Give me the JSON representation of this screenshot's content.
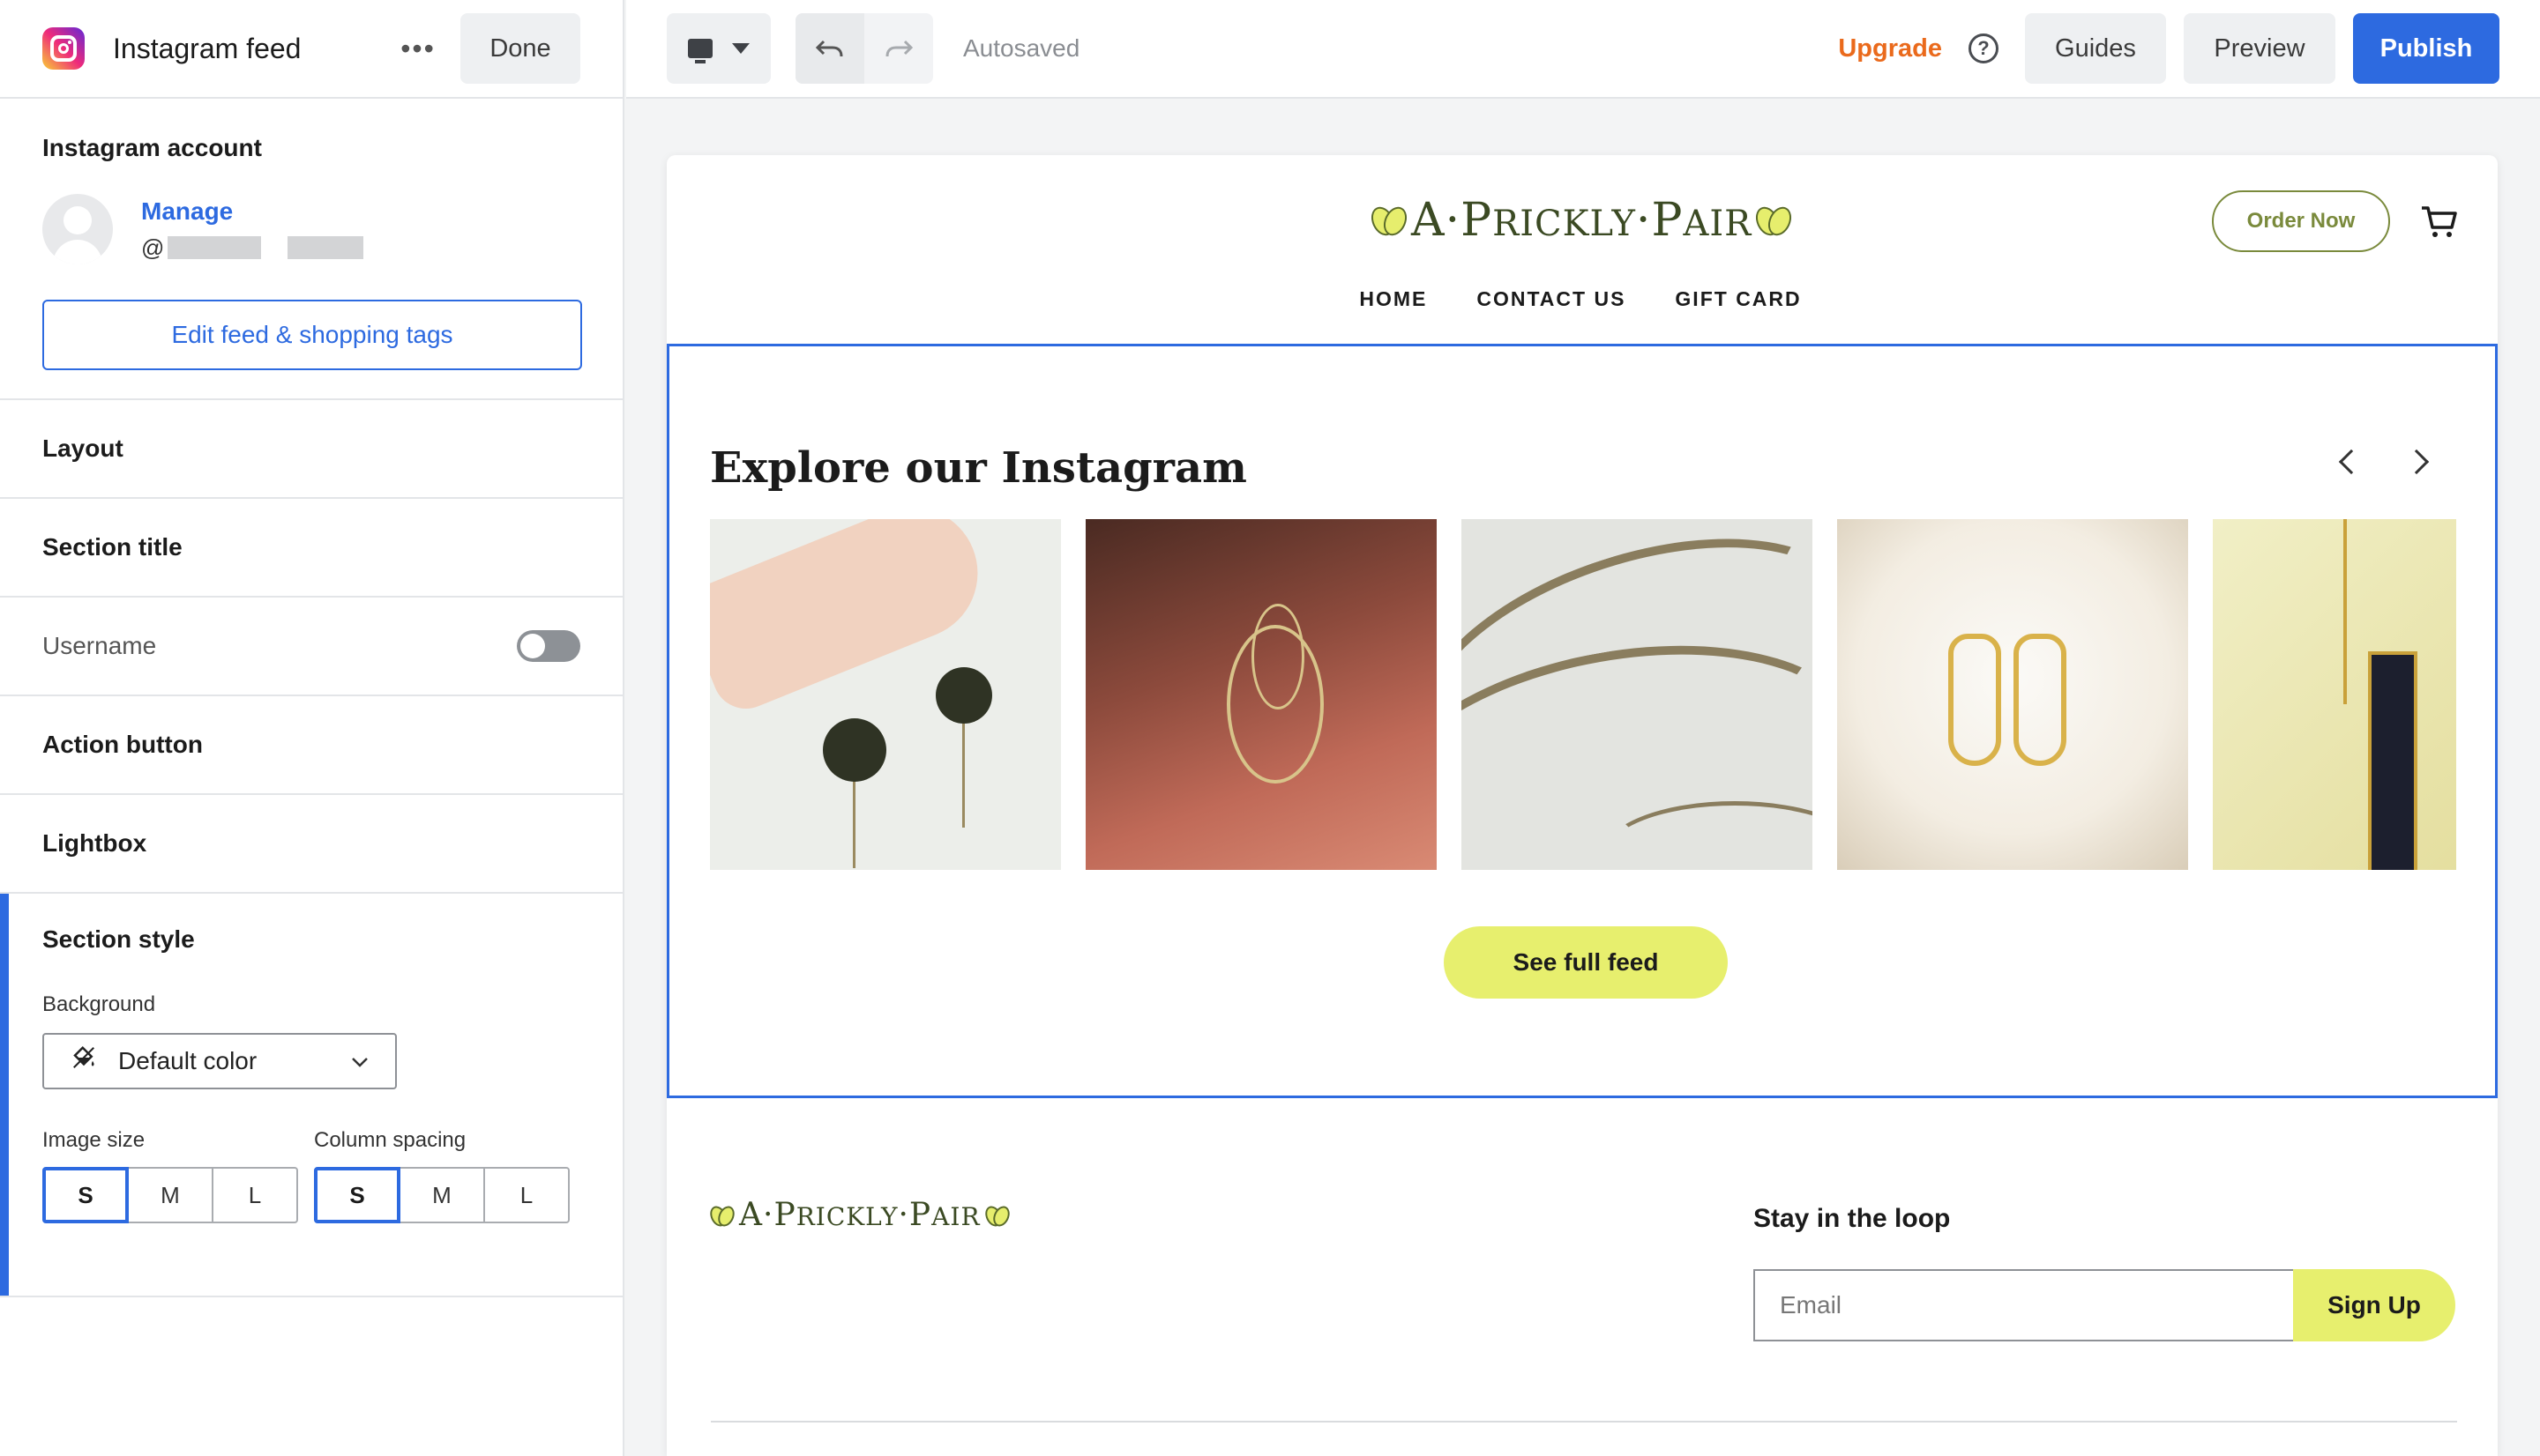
{
  "sidebar": {
    "title": "Instagram feed",
    "more_label": "•••",
    "done_label": "Done",
    "account": {
      "label": "Instagram account",
      "manage_label": "Manage",
      "handle_prefix": "@",
      "edit_button_label": "Edit feed & shopping tags"
    },
    "rows": [
      {
        "label": "Layout"
      },
      {
        "label": "Section title"
      },
      {
        "label": "Username",
        "toggle": false
      },
      {
        "label": "Action button"
      },
      {
        "label": "Lightbox"
      }
    ],
    "section_style": {
      "label": "Section style",
      "background_label": "Background",
      "background_value": "Default color",
      "image_size_label": "Image size",
      "image_size_options": [
        "S",
        "M",
        "L"
      ],
      "image_size_selected": "S",
      "column_spacing_label": "Column spacing",
      "column_spacing_options": [
        "S",
        "M",
        "L"
      ],
      "column_spacing_selected": "S"
    }
  },
  "topbar": {
    "autosaved": "Autosaved",
    "upgrade": "Upgrade",
    "help": "?",
    "guides": "Guides",
    "preview": "Preview",
    "publish": "Publish"
  },
  "site": {
    "brand": {
      "a": "A",
      "sep": "·",
      "w1_first": "P",
      "w1_rest": "RICKLY",
      "w2_first": "P",
      "w2_rest": "AIR"
    },
    "order_button": "Order Now",
    "nav": [
      "HOME",
      "CONTACT US",
      "GIFT CARD"
    ],
    "instagram": {
      "title": "Explore our Instagram",
      "see_full_feed": "See full feed"
    },
    "footer": {
      "loop_title": "Stay in the loop",
      "email_placeholder": "Email",
      "signup_label": "Sign Up"
    }
  },
  "colors": {
    "accent_blue": "#2d6ae0",
    "upgrade_orange": "#ea6a1c",
    "brand_yellow": "#e7ef6e",
    "brand_olive": "#7a8a3c"
  }
}
